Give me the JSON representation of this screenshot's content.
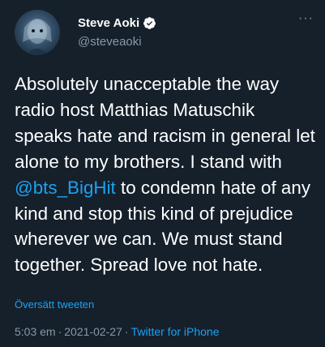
{
  "author": {
    "display_name": "Steve Aoki",
    "handle": "@steveaoki",
    "verified": true,
    "avatar_icon": "avatar-portrait"
  },
  "more_label": "···",
  "tweet": {
    "text_before": "Absolutely unacceptable the way radio host Matthias Matuschik speaks hate and racism in general let alone to my brothers. I stand with ",
    "mention": "@bts_BigHit",
    "text_after": " to condemn hate of any kind and stop this kind of prejudice wherever we can. We must stand together. Spread love not hate."
  },
  "translate_label": "Översätt tweeten",
  "meta": {
    "time": "5:03 em",
    "separator": "·",
    "date": "2021-02-27",
    "source": "Twitter for iPhone"
  },
  "colors": {
    "background": "#15202b",
    "text": "#ffffff",
    "secondary": "#8899a6",
    "accent": "#1da1f2"
  }
}
